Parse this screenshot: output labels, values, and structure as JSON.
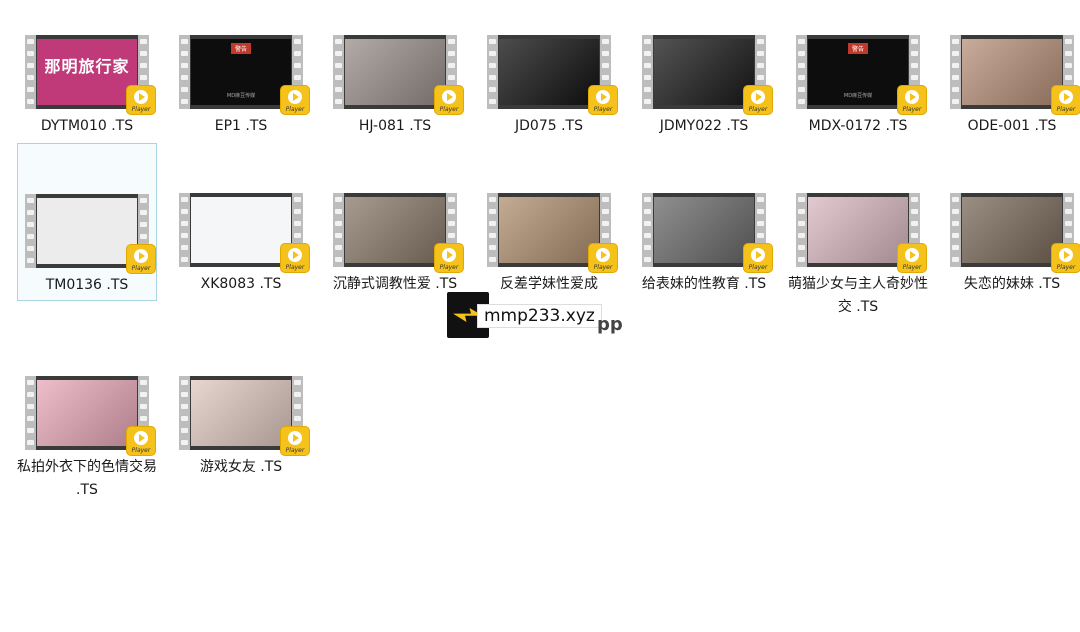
{
  "files": [
    {
      "label": "DYTM010 .TS",
      "thumb": "title",
      "thumb_text": "那明旅行家",
      "thumb_bg": "#c03a7a",
      "selected": false,
      "badge": "Player"
    },
    {
      "label": "EP1 .TS",
      "thumb": "caption",
      "thumb_bg": "#0d0d0d",
      "selected": false,
      "badge": "Player"
    },
    {
      "label": "HJ-081 .TS",
      "thumb": "scene",
      "thumb_bg": "#9a8f8a",
      "selected": false,
      "badge": "Player"
    },
    {
      "label": "JD075 .TS",
      "thumb": "scene",
      "thumb_bg": "#111111",
      "selected": false,
      "badge": "Player"
    },
    {
      "label": "JDMY022 .TS",
      "thumb": "scene",
      "thumb_bg": "#1a1a1a",
      "selected": false,
      "badge": "Player"
    },
    {
      "label": "MDX-0172 .TS",
      "thumb": "caption",
      "thumb_bg": "#0d0d0d",
      "selected": false,
      "badge": "Player"
    },
    {
      "label": "ODE-001 .TS",
      "thumb": "scene",
      "thumb_bg": "#b8907a",
      "selected": false,
      "badge": "Player"
    },
    {
      "label": "TM0136 .TS",
      "thumb": "blank",
      "thumb_bg": "#ececec",
      "selected": true,
      "badge": "Player"
    },
    {
      "label": "XK8083 .TS",
      "thumb": "blank",
      "thumb_bg": "#f4f6f8",
      "selected": false,
      "badge": "Player"
    },
    {
      "label": "沉静式调教性爱 .TS",
      "thumb": "scene",
      "thumb_bg": "#8a7a6a",
      "selected": false,
      "badge": "Player"
    },
    {
      "label": "反差学妹性爱成",
      "thumb": "scene",
      "thumb_bg": "#b09070",
      "selected": false,
      "badge": "Player"
    },
    {
      "label": "给表妹的性教育 .TS",
      "thumb": "scene",
      "thumb_bg": "#6a6a6a",
      "selected": false,
      "badge": "Player"
    },
    {
      "label": "萌猫少女与主人奇妙性交 .TS",
      "thumb": "scene",
      "thumb_bg": "#d8b8c0",
      "selected": false,
      "badge": "Player"
    },
    {
      "label": "失恋的妹妹 .TS",
      "thumb": "scene",
      "thumb_bg": "#7a6a5a",
      "selected": false,
      "badge": "Player"
    },
    {
      "label": "私拍外衣下的色情交易 .TS",
      "thumb": "scene",
      "thumb_bg": "#e8a8b8",
      "selected": false,
      "badge": "Player"
    },
    {
      "label": "游戏女友 .TS",
      "thumb": "scene",
      "thumb_bg": "#e0c8c0",
      "selected": false,
      "badge": "Player"
    }
  ],
  "caption_text": {
    "tag": "警告",
    "footer": "MD麻豆传媒"
  },
  "watermark": {
    "site": "mmp233.xyz",
    "suffix": "pp"
  },
  "colors": {
    "badge": "#f4c21a",
    "selection_border": "#a9d4e6"
  }
}
